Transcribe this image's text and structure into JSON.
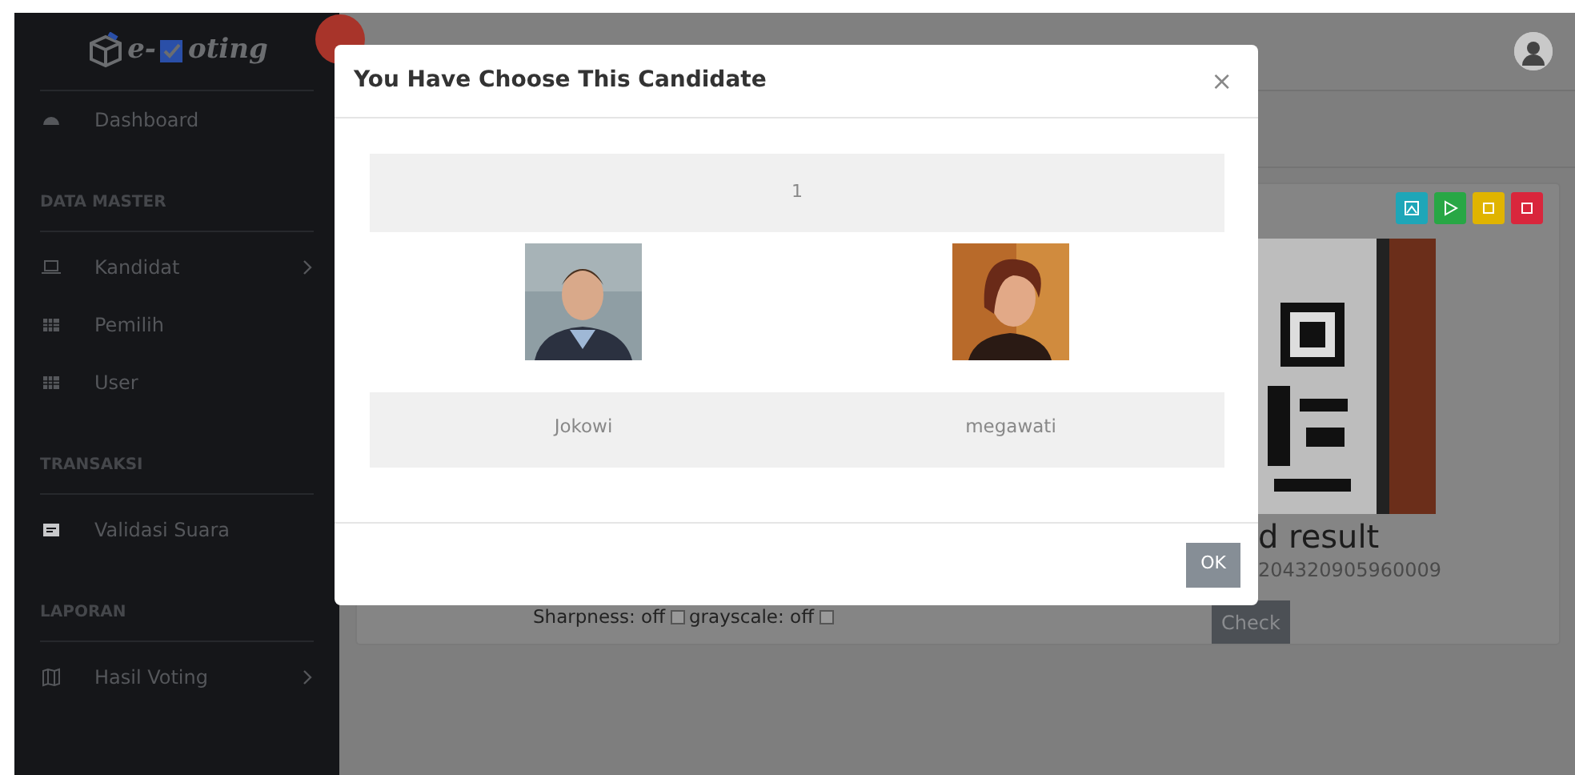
{
  "sidebar": {
    "logo": {
      "prefix": "e-",
      "suffix": "oting"
    },
    "items": [
      {
        "kind": "link",
        "label": "Dashboard",
        "has_submenu": false,
        "selected": false
      },
      {
        "kind": "heading",
        "label": "DATA MASTER"
      },
      {
        "kind": "link",
        "label": "Kandidat",
        "has_submenu": true,
        "selected": false
      },
      {
        "kind": "link",
        "label": "Pemilih",
        "has_submenu": false,
        "selected": false
      },
      {
        "kind": "link",
        "label": "User",
        "has_submenu": false,
        "selected": false
      },
      {
        "kind": "heading",
        "label": "TRANSAKSI"
      },
      {
        "kind": "link",
        "label": "Validasi Suara",
        "has_submenu": false,
        "selected": true
      },
      {
        "kind": "heading",
        "label": "LAPORAN"
      },
      {
        "kind": "link",
        "label": "Hasil Voting",
        "has_submenu": true,
        "selected": false
      }
    ]
  },
  "scanner": {
    "toolbar_buttons": [
      {
        "color": "#1ea6b8"
      },
      {
        "color": "#28a745"
      },
      {
        "color": "#e0b400"
      },
      {
        "color": "#d9263c"
      }
    ],
    "result_heading": "d result",
    "result_code": "204320905960009",
    "options": [
      {
        "label": "Sharpness: off",
        "checked": false
      },
      {
        "label": "grayscale: off",
        "checked": false
      }
    ],
    "check_button": "Check"
  },
  "modal": {
    "title": "You Have Choose This Candidate",
    "close_label": "×",
    "number": "1",
    "candidates": [
      {
        "name": "Jokowi"
      },
      {
        "name": "megawati"
      }
    ],
    "ok_button": "OK"
  }
}
